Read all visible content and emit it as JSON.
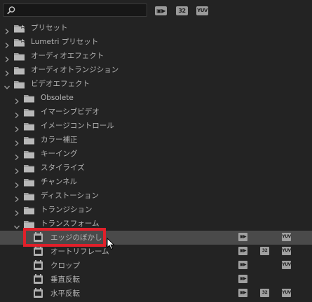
{
  "toolbar": {
    "search_placeholder": "",
    "filter_buttons": [
      {
        "label": "▣▶",
        "name": "accelerated-effects-filter"
      },
      {
        "label": "32",
        "name": "32bit-filter"
      },
      {
        "label": "YUV",
        "name": "yuv-filter"
      }
    ]
  },
  "tree": [
    {
      "depth": 0,
      "expanded": false,
      "type": "folder-star",
      "label": "プリセット"
    },
    {
      "depth": 0,
      "expanded": false,
      "type": "folder-star",
      "label": "Lumetri プリセット"
    },
    {
      "depth": 0,
      "expanded": false,
      "type": "folder",
      "label": "オーディオエフェクト"
    },
    {
      "depth": 0,
      "expanded": false,
      "type": "folder",
      "label": "オーディオトランジション"
    },
    {
      "depth": 0,
      "expanded": true,
      "type": "folder",
      "label": "ビデオエフェクト"
    },
    {
      "depth": 1,
      "expanded": false,
      "type": "folder",
      "label": "Obsolete"
    },
    {
      "depth": 1,
      "expanded": false,
      "type": "folder",
      "label": "イマーシブビデオ"
    },
    {
      "depth": 1,
      "expanded": false,
      "type": "folder",
      "label": "イメージコントロール"
    },
    {
      "depth": 1,
      "expanded": false,
      "type": "folder",
      "label": "カラー補正"
    },
    {
      "depth": 1,
      "expanded": false,
      "type": "folder",
      "label": "キーイング"
    },
    {
      "depth": 1,
      "expanded": false,
      "type": "folder",
      "label": "スタイライズ"
    },
    {
      "depth": 1,
      "expanded": false,
      "type": "folder",
      "label": "チャンネル"
    },
    {
      "depth": 1,
      "expanded": false,
      "type": "folder",
      "label": "ディストーション"
    },
    {
      "depth": 1,
      "expanded": false,
      "type": "folder",
      "label": "トランジション"
    },
    {
      "depth": 1,
      "expanded": true,
      "type": "folder",
      "label": "トランスフォーム"
    },
    {
      "depth": 2,
      "type": "effect",
      "label": "エッジのぼかし",
      "selected": true,
      "accel": true,
      "b32": false,
      "yuv": true
    },
    {
      "depth": 2,
      "type": "effect",
      "label": "オートリフレーム",
      "accel": true,
      "b32": true,
      "yuv": true
    },
    {
      "depth": 2,
      "type": "effect",
      "label": "クロップ",
      "accel": true,
      "b32": false,
      "yuv": true
    },
    {
      "depth": 2,
      "type": "effect",
      "label": "垂直反転",
      "accel": true,
      "b32": false,
      "yuv": false
    },
    {
      "depth": 2,
      "type": "effect",
      "label": "水平反転",
      "accel": true,
      "b32": true,
      "yuv": true
    }
  ],
  "badges": {
    "accel": "▣▶",
    "b32": "32",
    "yuv": "YUV"
  },
  "colors": {
    "background": "#232323",
    "selected_row": "#4a4a4a",
    "highlight": "#e0202a",
    "text": "#b4b4b4"
  }
}
